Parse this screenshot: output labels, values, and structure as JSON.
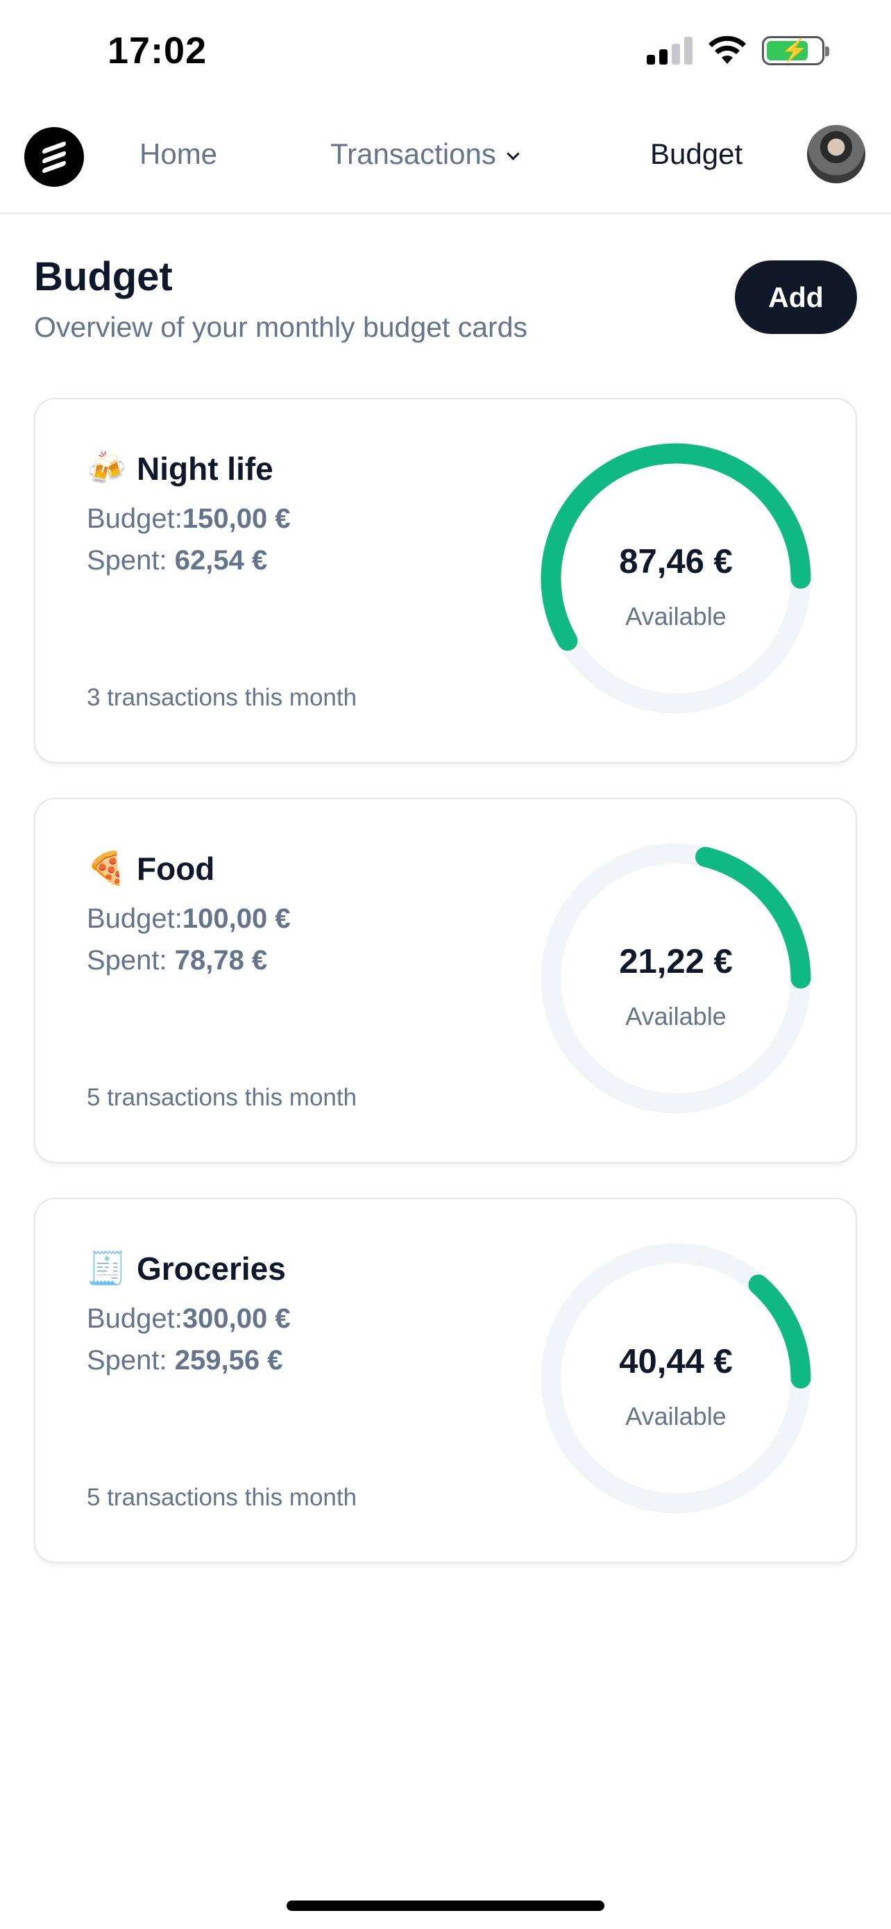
{
  "status_bar": {
    "time": "17:02"
  },
  "nav": {
    "items": [
      {
        "label": "Home"
      },
      {
        "label": "Transactions"
      },
      {
        "label": "Budget"
      }
    ]
  },
  "header": {
    "title": "Budget",
    "subtitle": "Overview of your monthly budget cards",
    "add_label": "Add"
  },
  "labels": {
    "budget_prefix": "Budget:",
    "spent_prefix": "Spent: ",
    "available": "Available"
  },
  "colors": {
    "ring_fill": "#10b981",
    "ring_track": "#f1f5f9"
  },
  "cards": [
    {
      "emoji": "🍻",
      "icon": "beer-mugs-icon",
      "name": "Night life",
      "budget": "150,00 €",
      "spent": "62,54 €",
      "available": "87,46 €",
      "transactions": "3 transactions this month",
      "spent_fraction": 0.417
    },
    {
      "emoji": "🍕",
      "icon": "pizza-icon",
      "name": "Food",
      "budget": "100,00 €",
      "spent": "78,78 €",
      "available": "21,22 €",
      "transactions": "5 transactions this month",
      "spent_fraction": 0.788
    },
    {
      "emoji": "🧾",
      "icon": "receipt-icon",
      "name": "Groceries",
      "budget": "300,00 €",
      "spent": "259,56 €",
      "available": "40,44 €",
      "transactions": "5 transactions this month",
      "spent_fraction": 0.865
    }
  ]
}
